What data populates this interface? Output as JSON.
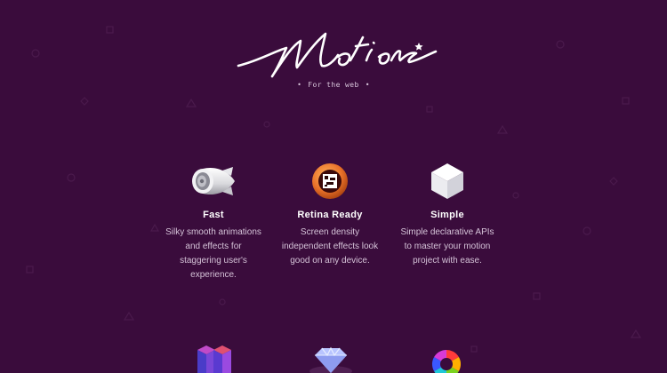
{
  "brand": {
    "logo_text": "Motion"
  },
  "tagline": "For the web",
  "features": [
    {
      "title": "Fast",
      "description": "Silky smooth animations and effects for staggering user's experience.",
      "icon": "jet-engine-icon"
    },
    {
      "title": "Retina Ready",
      "description": "Screen density independent effects look good on any device.",
      "icon": "retina-eye-icon"
    },
    {
      "title": "Simple",
      "description": "Simple declarative APIs to master your motion project with ease.",
      "icon": "cube-icon"
    }
  ],
  "more_features_icons": [
    "modular-cubes-icon",
    "diamond-icon",
    "color-wheel-icon"
  ],
  "colors": {
    "background": "#3a0c3c",
    "text": "#ffffff",
    "muted_text": "#d5c3d8",
    "accent": "#e8722a"
  }
}
